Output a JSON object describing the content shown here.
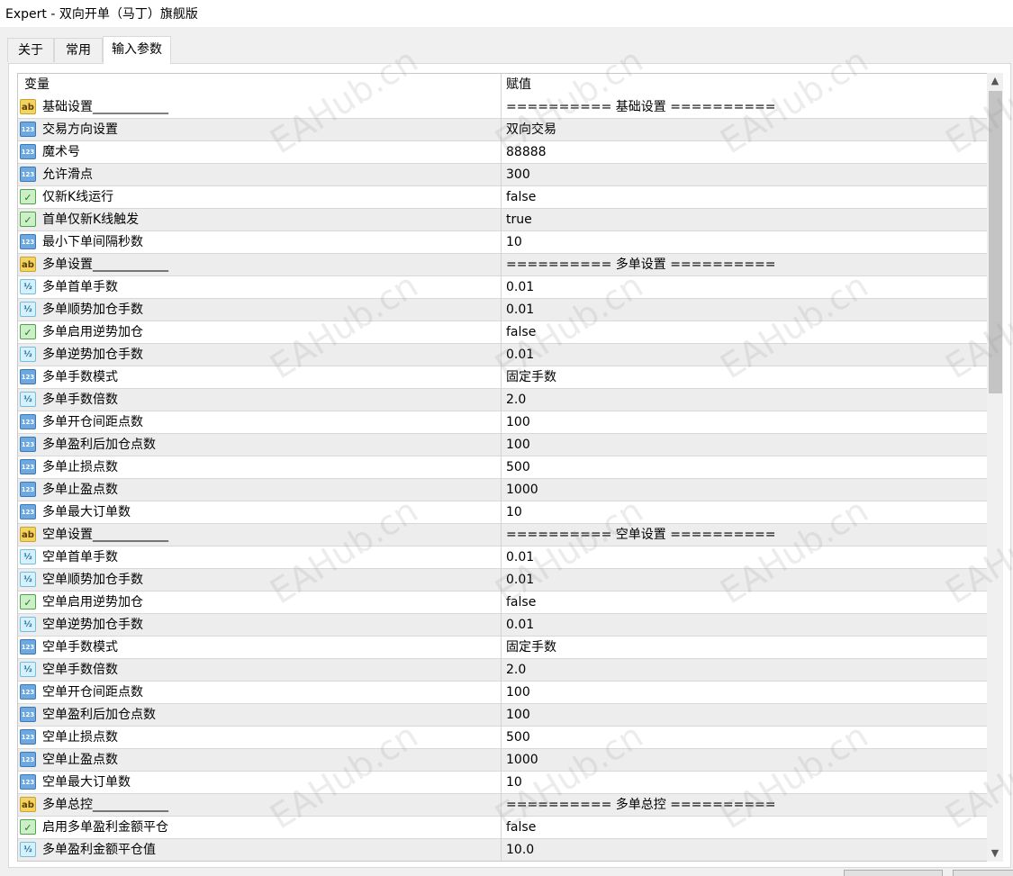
{
  "window": {
    "title": "Expert - 双向开单（马丁）旗舰版"
  },
  "tabs": [
    {
      "label": "关于"
    },
    {
      "label": "常用"
    },
    {
      "label": "输入参数"
    }
  ],
  "table": {
    "headers": {
      "variable": "变量",
      "value": "赋值"
    },
    "rows": [
      {
        "type": "string",
        "name": "基础设置____________",
        "value": "========== 基础设置 =========="
      },
      {
        "type": "int",
        "name": "交易方向设置",
        "value": "双向交易"
      },
      {
        "type": "int",
        "name": "魔术号",
        "value": "88888"
      },
      {
        "type": "int",
        "name": "允许滑点",
        "value": "300"
      },
      {
        "type": "bool",
        "name": "仅新K线运行",
        "value": "false"
      },
      {
        "type": "bool",
        "name": "首单仅新K线触发",
        "value": "true"
      },
      {
        "type": "int",
        "name": "最小下单间隔秒数",
        "value": "10"
      },
      {
        "type": "string",
        "name": "多单设置____________",
        "value": "========== 多单设置 =========="
      },
      {
        "type": "double",
        "name": "多单首单手数",
        "value": "0.01"
      },
      {
        "type": "double",
        "name": "多单顺势加仓手数",
        "value": "0.01"
      },
      {
        "type": "bool",
        "name": "多单启用逆势加仓",
        "value": "false"
      },
      {
        "type": "double",
        "name": "多单逆势加仓手数",
        "value": "0.01"
      },
      {
        "type": "int",
        "name": "多单手数模式",
        "value": "固定手数"
      },
      {
        "type": "double",
        "name": "多单手数倍数",
        "value": "2.0"
      },
      {
        "type": "int",
        "name": "多单开仓间距点数",
        "value": "100"
      },
      {
        "type": "int",
        "name": "多单盈利后加仓点数",
        "value": "100"
      },
      {
        "type": "int",
        "name": "多单止损点数",
        "value": "500"
      },
      {
        "type": "int",
        "name": "多单止盈点数",
        "value": "1000"
      },
      {
        "type": "int",
        "name": "多单最大订单数",
        "value": "10"
      },
      {
        "type": "string",
        "name": "空单设置____________",
        "value": "========== 空单设置 =========="
      },
      {
        "type": "double",
        "name": "空单首单手数",
        "value": "0.01"
      },
      {
        "type": "double",
        "name": "空单顺势加仓手数",
        "value": "0.01"
      },
      {
        "type": "bool",
        "name": "空单启用逆势加仓",
        "value": "false"
      },
      {
        "type": "double",
        "name": "空单逆势加仓手数",
        "value": "0.01"
      },
      {
        "type": "int",
        "name": "空单手数模式",
        "value": "固定手数"
      },
      {
        "type": "double",
        "name": "空单手数倍数",
        "value": "2.0"
      },
      {
        "type": "int",
        "name": "空单开仓间距点数",
        "value": "100"
      },
      {
        "type": "int",
        "name": "空单盈利后加仓点数",
        "value": "100"
      },
      {
        "type": "int",
        "name": "空单止损点数",
        "value": "500"
      },
      {
        "type": "int",
        "name": "空单止盈点数",
        "value": "1000"
      },
      {
        "type": "int",
        "name": "空单最大订单数",
        "value": "10"
      },
      {
        "type": "string",
        "name": "多单总控____________",
        "value": "========== 多单总控 =========="
      },
      {
        "type": "bool",
        "name": "启用多单盈利金额平仓",
        "value": "false"
      },
      {
        "type": "double",
        "name": "多单盈利金额平仓值",
        "value": "10.0"
      }
    ]
  },
  "icons": {
    "string": {
      "name": "string-type-icon",
      "glyph": "ab"
    },
    "int": {
      "name": "integer-type-icon",
      "glyph": "123"
    },
    "double": {
      "name": "double-type-icon",
      "glyph": "½"
    },
    "bool": {
      "name": "boolean-type-icon",
      "glyph": "✓"
    }
  },
  "watermark": {
    "text": "EAHub.cn"
  }
}
